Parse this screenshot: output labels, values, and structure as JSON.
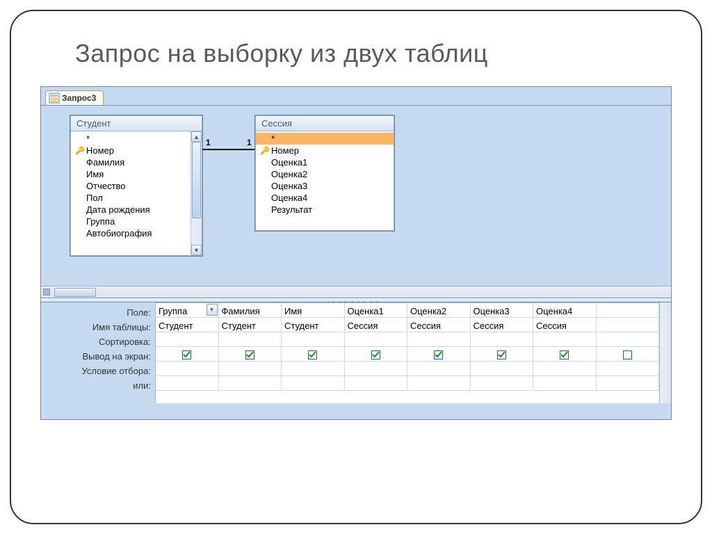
{
  "slide_title": "Запрос на выборку из двух таблиц",
  "tab_label": "Запрос3",
  "relation": {
    "left": "1",
    "right": "1"
  },
  "tables": [
    {
      "name": "Студент",
      "scroll": true,
      "fields": [
        {
          "label": "*",
          "key": false,
          "sel": false
        },
        {
          "label": "Номер",
          "key": true,
          "sel": false
        },
        {
          "label": "Фамилия",
          "key": false,
          "sel": false
        },
        {
          "label": "Имя",
          "key": false,
          "sel": false
        },
        {
          "label": "Отчество",
          "key": false,
          "sel": false
        },
        {
          "label": "Пол",
          "key": false,
          "sel": false
        },
        {
          "label": "Дата рождения",
          "key": false,
          "sel": false
        },
        {
          "label": "Группа",
          "key": false,
          "sel": false
        },
        {
          "label": "Автобиография",
          "key": false,
          "sel": false
        }
      ]
    },
    {
      "name": "Сессия",
      "scroll": false,
      "fields": [
        {
          "label": "*",
          "key": false,
          "sel": true
        },
        {
          "label": "Номер",
          "key": true,
          "sel": false
        },
        {
          "label": "Оценка1",
          "key": false,
          "sel": false
        },
        {
          "label": "Оценка2",
          "key": false,
          "sel": false
        },
        {
          "label": "Оценка3",
          "key": false,
          "sel": false
        },
        {
          "label": "Оценка4",
          "key": false,
          "sel": false
        },
        {
          "label": "Результат",
          "key": false,
          "sel": false
        }
      ]
    }
  ],
  "grid_labels": [
    "Поле:",
    "Имя таблицы:",
    "Сортировка:",
    "Вывод на экран:",
    "Условие отбора:",
    "или:"
  ],
  "columns": [
    {
      "field": "Группа",
      "table": "Студент",
      "show": true,
      "dd": true
    },
    {
      "field": "Фамилия",
      "table": "Студент",
      "show": true,
      "dd": false
    },
    {
      "field": "Имя",
      "table": "Студент",
      "show": true,
      "dd": false
    },
    {
      "field": "Оценка1",
      "table": "Сессия",
      "show": true,
      "dd": false
    },
    {
      "field": "Оценка2",
      "table": "Сессия",
      "show": true,
      "dd": false
    },
    {
      "field": "Оценка3",
      "table": "Сессия",
      "show": true,
      "dd": false
    },
    {
      "field": "Оценка4",
      "table": "Сессия",
      "show": true,
      "dd": false
    }
  ]
}
